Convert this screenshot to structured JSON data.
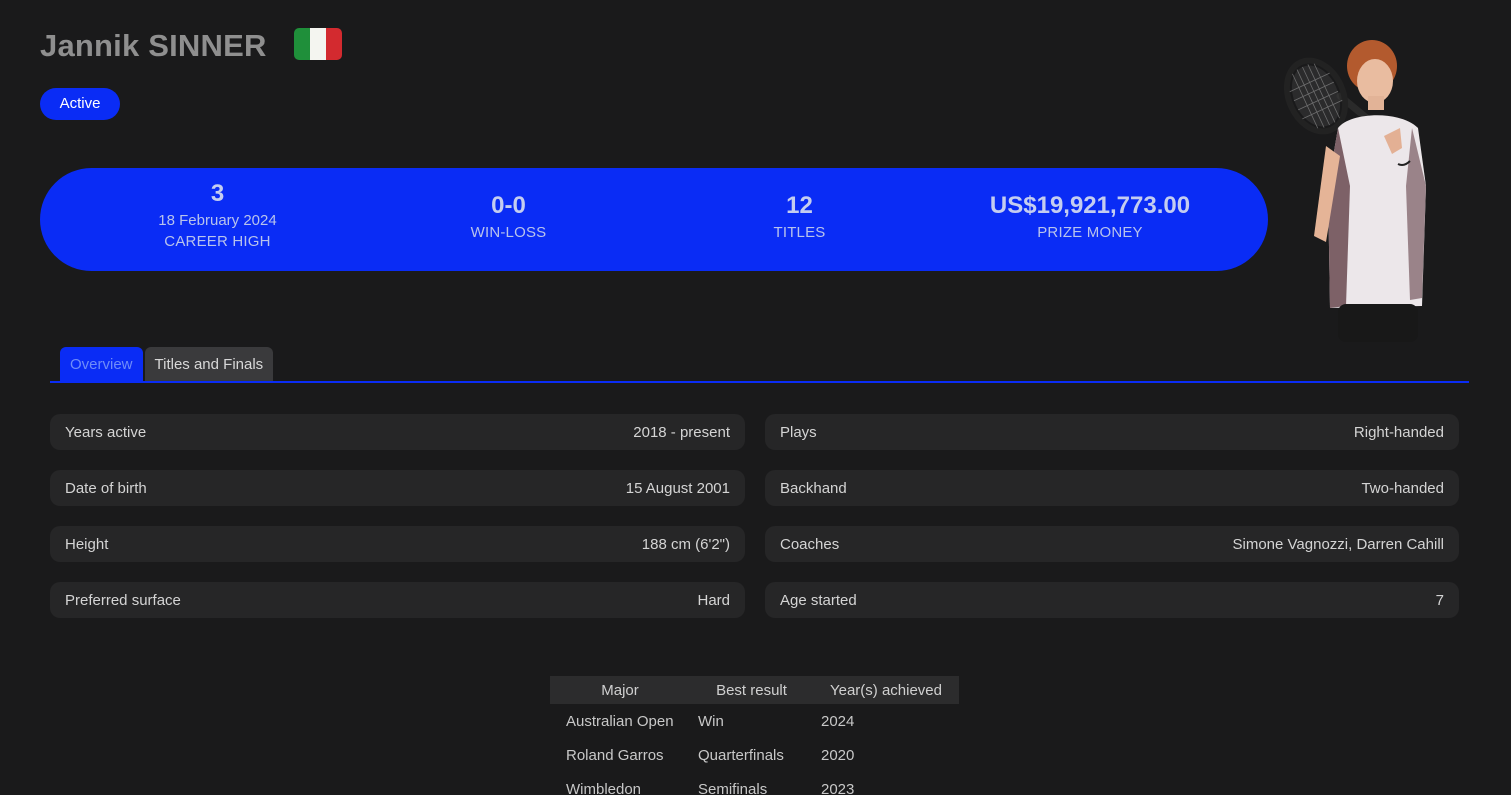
{
  "player": {
    "name": "Jannik SINNER",
    "status": "Active",
    "flag_colors": [
      "#1f8f3a",
      "#f4f5f0",
      "#d32a2f"
    ]
  },
  "stats": {
    "ranking": "3",
    "ranking_date": "18 February 2024",
    "ranking_label": "CAREER HIGH",
    "win_loss": "0-0",
    "win_loss_label": "WIN-LOSS",
    "titles": "12",
    "titles_label": "TITLES",
    "prize_money": "US$19,921,773.00",
    "prize_money_label": "PRIZE MONEY"
  },
  "tabs": [
    {
      "label": "Overview",
      "active": true
    },
    {
      "label": "Titles and Finals",
      "active": false
    }
  ],
  "overview": {
    "left": [
      {
        "label": "Years active",
        "value": "2018 - present"
      },
      {
        "label": "Date of birth",
        "value": "15 August 2001"
      },
      {
        "label": "Height",
        "value": "188 cm (6'2\")"
      },
      {
        "label": "Preferred surface",
        "value": "Hard"
      }
    ],
    "right": [
      {
        "label": "Plays",
        "value": "Right-handed"
      },
      {
        "label": "Backhand",
        "value": "Two-handed"
      },
      {
        "label": "Coaches",
        "value": "Simone Vagnozzi, Darren Cahill"
      },
      {
        "label": "Age started",
        "value": "7"
      }
    ]
  },
  "majors": {
    "headers": [
      "Major",
      "Best result",
      "Year(s) achieved"
    ],
    "rows": [
      [
        "Australian Open",
        "Win",
        "2024"
      ],
      [
        "Roland Garros",
        "Quarterfinals",
        "2020"
      ],
      [
        "Wimbledon",
        "Semifinals",
        "2023"
      ]
    ]
  },
  "colors": {
    "accent": "#0a2cf5",
    "background": "#1a1a1b",
    "row_background": "#262627"
  }
}
